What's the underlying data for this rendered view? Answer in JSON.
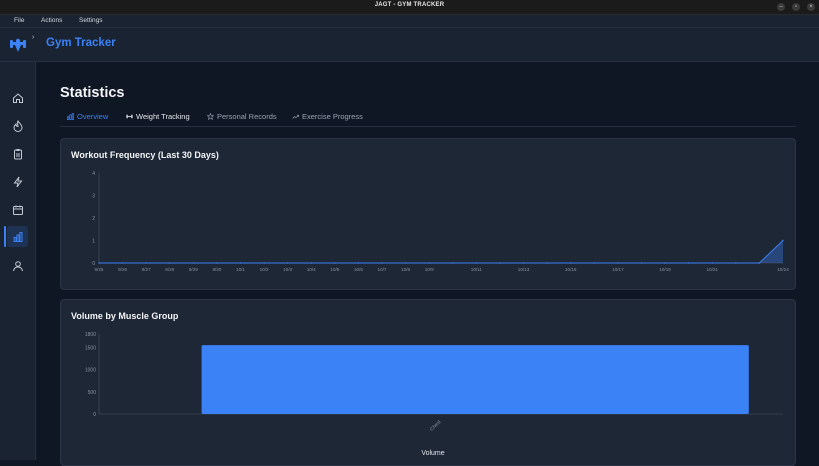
{
  "window": {
    "title": "JAGT - GYM TRACKER"
  },
  "menu": {
    "file": "File",
    "actions": "Actions",
    "settings": "Settings"
  },
  "header": {
    "app_name": "Gym Tracker"
  },
  "sidebar": {
    "items": [
      {
        "icon": "home-icon"
      },
      {
        "icon": "flame-icon"
      },
      {
        "icon": "clipboard-icon"
      },
      {
        "icon": "lightning-icon"
      },
      {
        "icon": "calendar-icon"
      },
      {
        "icon": "bar-chart-icon",
        "active": true
      },
      {
        "icon": "user-icon"
      }
    ]
  },
  "page": {
    "title": "Statistics",
    "tabs": [
      {
        "label": "Overview",
        "icon": "bar-chart-icon",
        "active": true
      },
      {
        "label": "Weight Tracking",
        "icon": "dumbbell-icon"
      },
      {
        "label": "Personal Records",
        "icon": "star-icon"
      },
      {
        "label": "Exercise Progress",
        "icon": "trend-up-icon"
      }
    ]
  },
  "colors": {
    "accent": "#3b82f6",
    "card": "#1e2736",
    "bg": "#0f1624"
  },
  "chart_data": [
    {
      "type": "area",
      "title": "Workout Frequency (Last 30 Days)",
      "categories": [
        "9/25",
        "9/26",
        "9/27",
        "9/28",
        "9/29",
        "9/30",
        "10/1",
        "10/2",
        "10/3",
        "10/4",
        "10/5",
        "10/6",
        "10/7",
        "10/8",
        "10/9",
        "10/10",
        "10/11",
        "10/12",
        "10/13",
        "10/14",
        "10/15",
        "10/16",
        "10/17",
        "10/18",
        "10/19",
        "10/20",
        "10/21",
        "10/22",
        "10/23",
        "10/24"
      ],
      "tick_labels": [
        "9/25",
        "9/26",
        "9/27",
        "9/28",
        "9/29",
        "9/30",
        "10/1",
        "10/2",
        "10/3",
        "10/4",
        "10/5",
        "10/6",
        "10/7",
        "10/8",
        "10/9",
        "10/11",
        "10/13",
        "10/15",
        "10/17",
        "10/19",
        "10/21",
        "10/24"
      ],
      "values": [
        0,
        0,
        0,
        0,
        0,
        0,
        0,
        0,
        0,
        0,
        0,
        0,
        0,
        0,
        0,
        0,
        0,
        0,
        0,
        0,
        0,
        0,
        0,
        0,
        0,
        0,
        0,
        0,
        0,
        1
      ],
      "yticks": [
        0,
        1,
        2,
        3,
        4
      ],
      "ylim": [
        0,
        4
      ],
      "grid": false
    },
    {
      "type": "bar",
      "title": "Volume by Muscle Group",
      "categories": [
        "Chest"
      ],
      "series": [
        {
          "name": "Volume",
          "values": [
            1550
          ]
        }
      ],
      "yticks": [
        0,
        500,
        1000,
        1500
      ],
      "ytick_labels": [
        "0",
        "500",
        "1000",
        "1500",
        "1800"
      ],
      "ylim": [
        0,
        1800
      ],
      "legend": "bottom",
      "grid": false
    }
  ]
}
